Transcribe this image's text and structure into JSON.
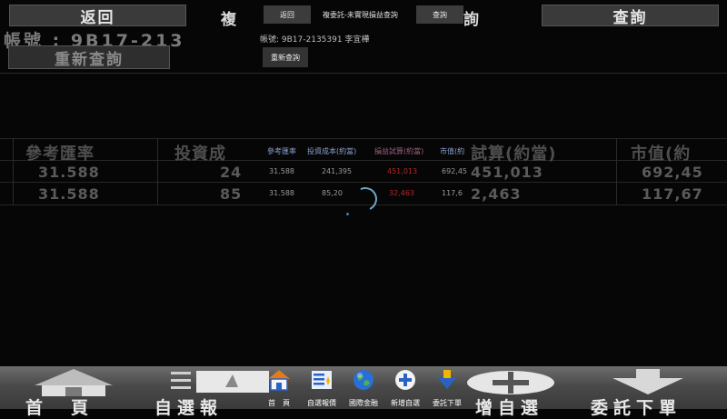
{
  "background": {
    "back_label": "返回",
    "query_label": "查詢",
    "title": "複委託-未實現損益查詢",
    "title_visible": "複",
    "title_suffix": "詢",
    "account_text": "帳號 : 9B17-213",
    "requery_label": "重新查詢",
    "headers": [
      "參考匯率",
      "投資成",
      "試算(約當)",
      "市值(約"
    ],
    "rows": [
      [
        "31.588",
        "24",
        "451,013",
        "692,45"
      ],
      [
        "31.588",
        "85",
        "2,463",
        "117,67"
      ]
    ]
  },
  "foreground": {
    "back_label": "返回",
    "title": "複委託-未實現損益查詢",
    "query_label": "查詢",
    "account_text": "帳號: 9B17-2135391 李宜樺",
    "requery_label": "重新查詢",
    "headers": [
      "參考匯率",
      "投資成本(約當)",
      "損益試算(約當)",
      "市值(約"
    ],
    "rows": [
      [
        "31.588",
        "241,395",
        "451,013",
        "692,45"
      ],
      [
        "31.588",
        "85,20",
        "32,463",
        "117,6"
      ]
    ],
    "loss_color": "#b02a2a"
  },
  "nav": {
    "big_labels": [
      "首　頁",
      "自選報",
      "增自選",
      "委託下單"
    ],
    "items": [
      {
        "label": "首　頁",
        "icon": "home-icon"
      },
      {
        "label": "自選報價",
        "icon": "watchlist-icon"
      },
      {
        "label": "國際金融",
        "icon": "globe-icon"
      },
      {
        "label": "新增自選",
        "icon": "add-icon"
      },
      {
        "label": "委託下單",
        "icon": "download-arrow-icon"
      }
    ]
  }
}
